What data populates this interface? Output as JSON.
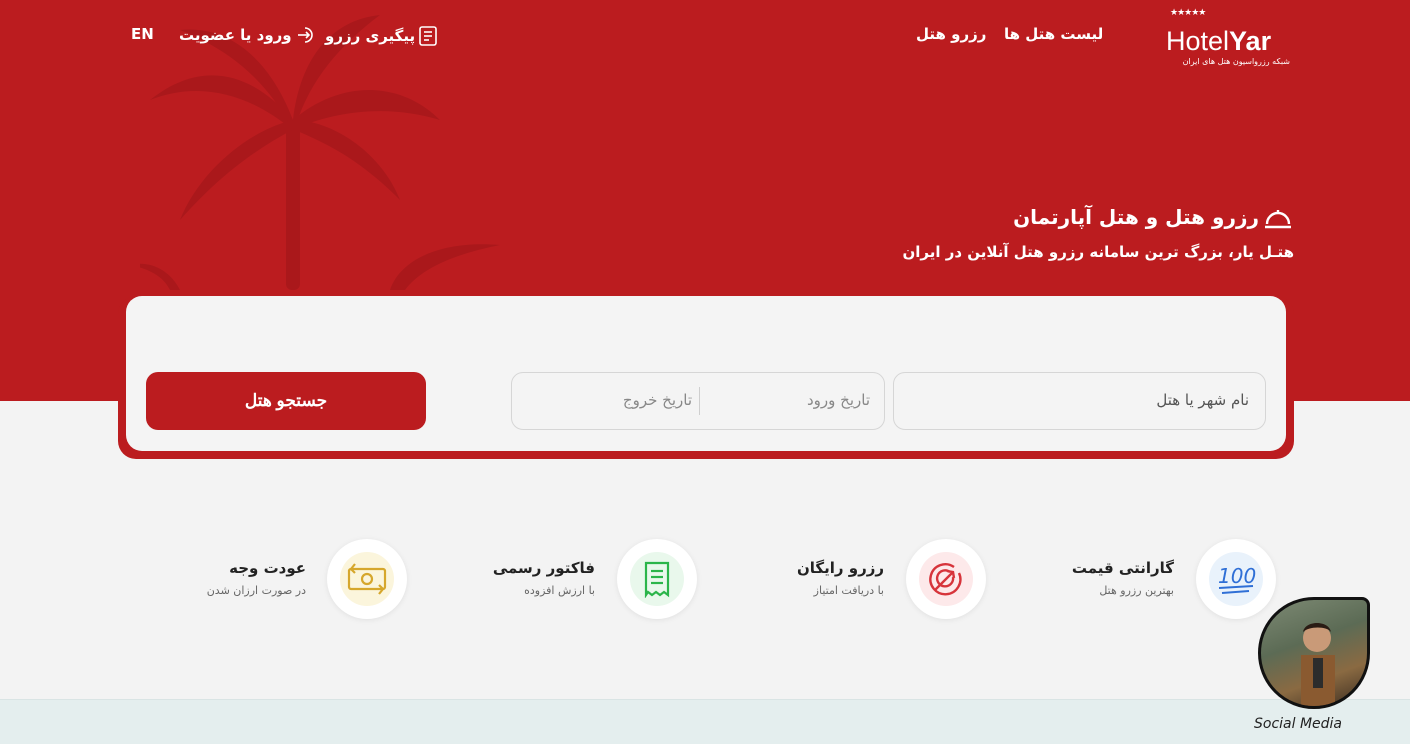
{
  "header": {
    "logo_text_a": "Hotel",
    "logo_text_b": "Yar",
    "logo_tagline": "شبکه رزرواسیون هتل های ایران",
    "nav_hotel_list": "لیست هتل ها",
    "nav_reserve_hotel": "رزرو هتل",
    "track_reservation": "پیگیری رزرو",
    "login_signup": "ورود یا عضویت",
    "language": "EN"
  },
  "hero": {
    "title": "رزرو هتل و هتل آپارتمان",
    "subtitle": "هتـل یار، بزرگ ترین سامانه رزرو هتل آنلاین در ایران"
  },
  "search": {
    "city_placeholder": "نام شهر یا هتل",
    "checkin_placeholder": "تاریخ ورود",
    "checkout_placeholder": "تاریخ خروج",
    "button_label": "جستجو هتل"
  },
  "features": [
    {
      "title": "گارانتی قیمت",
      "desc": "بهترین رزرو هتل",
      "icon": "hundred-icon"
    },
    {
      "title": "رزرو رایگان",
      "desc": "با دریافت امتیاز",
      "icon": "target-arrow-icon"
    },
    {
      "title": "فاکتور رسمی",
      "desc": "با ارزش افزوده",
      "icon": "receipt-icon"
    },
    {
      "title": "عودت وجه",
      "desc": "در صورت ارزان شدن",
      "icon": "money-return-icon"
    }
  ],
  "social_label": "Social Media",
  "colors": {
    "brand_red": "#bb1c1f",
    "background": "#f3f3f3"
  }
}
